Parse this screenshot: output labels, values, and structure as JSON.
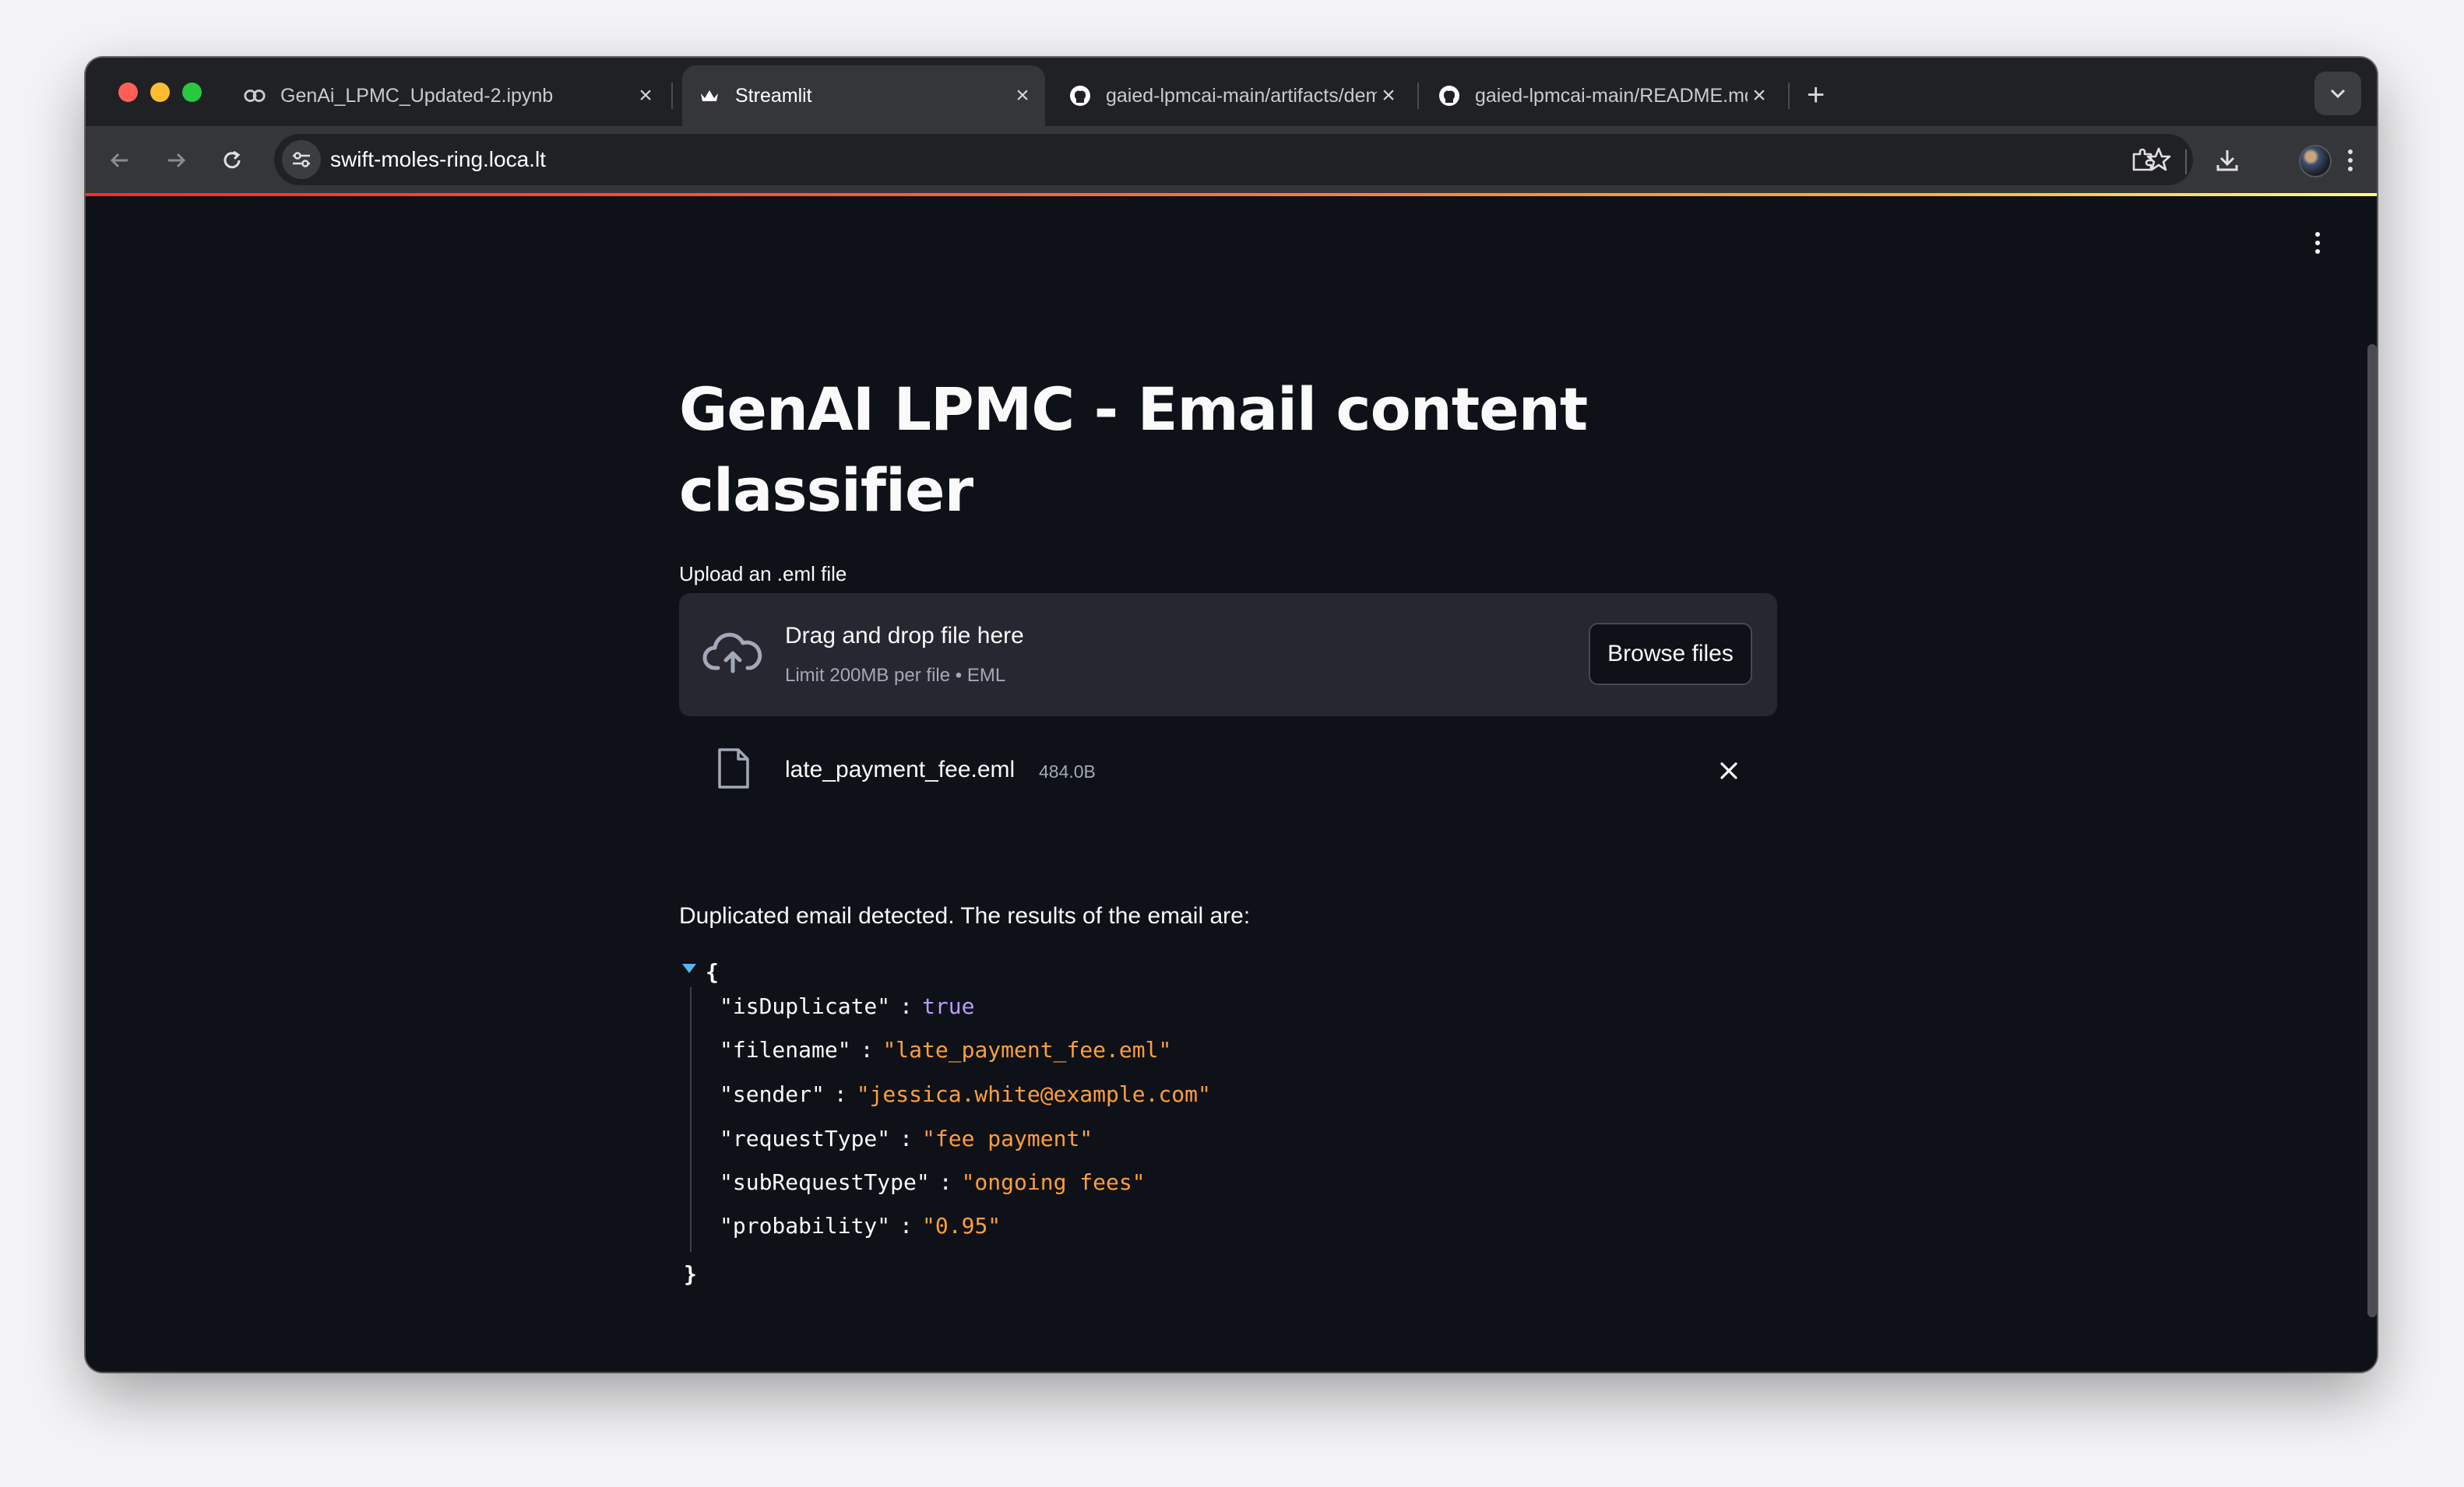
{
  "browser": {
    "tabs": [
      {
        "title": "GenAi_LPMC_Updated-2.ipynb",
        "icon": "colab-icon",
        "active": false
      },
      {
        "title": "Streamlit",
        "icon": "streamlit-crown-icon",
        "active": true
      },
      {
        "title": "gaied-lpmcai-main/artifacts/demo",
        "icon": "github-icon",
        "active": false
      },
      {
        "title": "gaied-lpmcai-main/README.md",
        "icon": "github-icon",
        "active": false
      }
    ],
    "url": "swift-moles-ring.loca.lt",
    "accent_gradient": [
      "#ff2b2b",
      "#fffd80"
    ]
  },
  "app": {
    "title": "GenAI LPMC - Email content classifier",
    "uploader": {
      "label": "Upload an .eml file",
      "drop_text": "Drag and drop file here",
      "limit_text": "Limit 200MB per file • EML",
      "browse_label": "Browse files"
    },
    "uploaded_file": {
      "name": "late_payment_fee.eml",
      "size": "484.0B"
    },
    "message": "Duplicated email detected. The results of the email are:",
    "result": {
      "open_brace": "{",
      "close_brace": "}",
      "rows": [
        {
          "key": "\"isDuplicate\"",
          "value": "true",
          "type": "bool"
        },
        {
          "key": "\"filename\"",
          "value": "\"late_payment_fee.eml\"",
          "type": "string"
        },
        {
          "key": "\"sender\"",
          "value": "\"jessica.white@example.com\"",
          "type": "string"
        },
        {
          "key": "\"requestType\"",
          "value": "\"fee payment\"",
          "type": "string"
        },
        {
          "key": "\"subRequestType\"",
          "value": "\"ongoing fees\"",
          "type": "string"
        },
        {
          "key": "\"probability\"",
          "value": "\"0.95\"",
          "type": "string"
        }
      ],
      "colon": ":"
    },
    "colors": {
      "background": "#0e1117",
      "surface": "#262730",
      "json_string": "#ff9e3d",
      "json_bool": "#b79cff"
    }
  }
}
